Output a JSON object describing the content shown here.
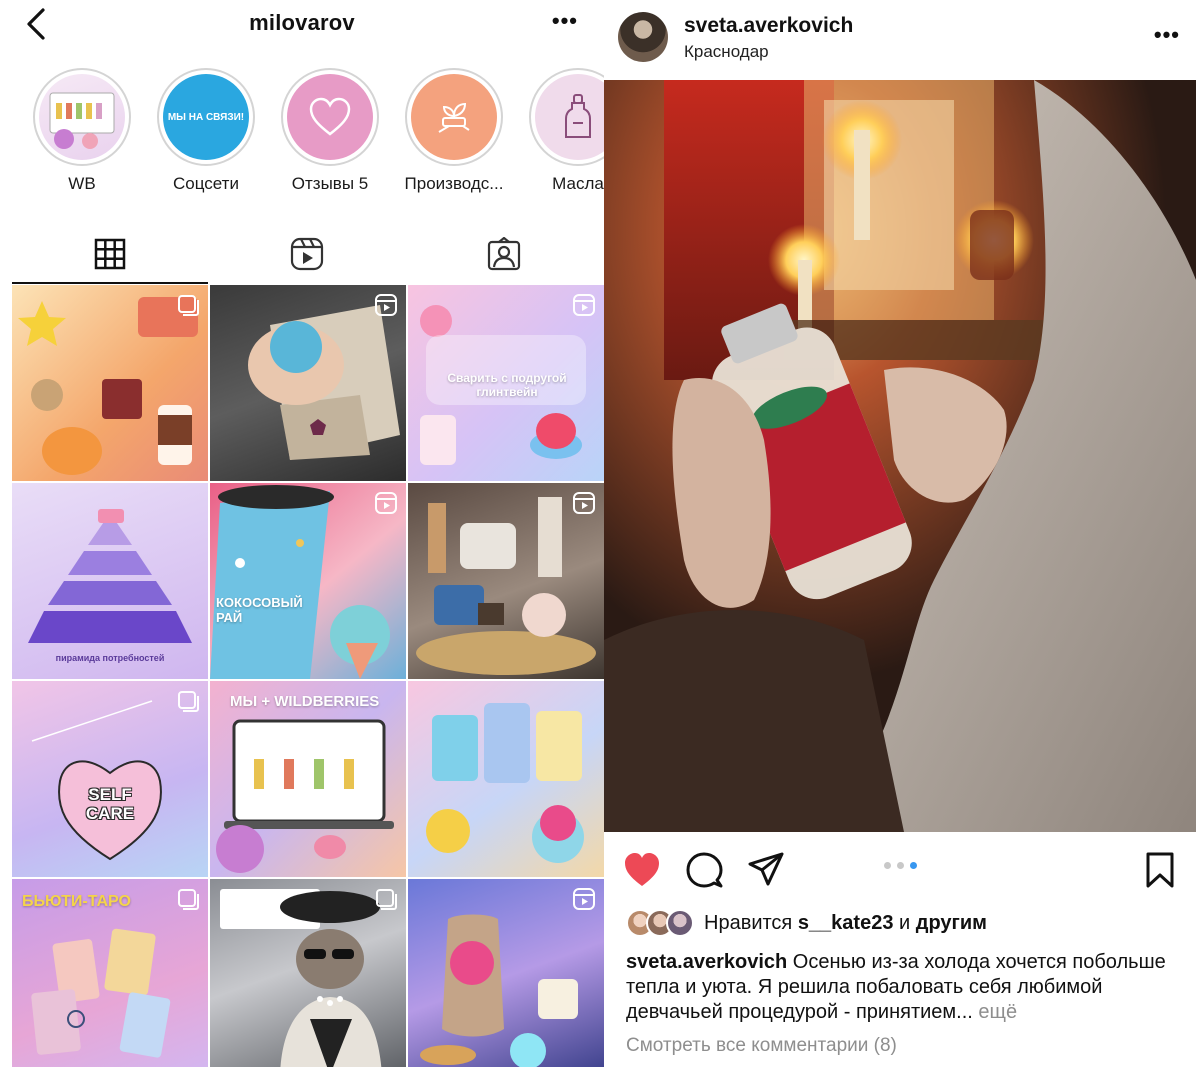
{
  "profile": {
    "username": "milovarov",
    "more": "•••",
    "highlights": [
      {
        "label": "WB",
        "icon": "laptop-products-thumb"
      },
      {
        "label": "Соцсети",
        "icon": "we-are-online-thumb",
        "thumb_text": "МЫ НА СВЯЗИ!"
      },
      {
        "label": "Отзывы 5",
        "icon": "heart-icon"
      },
      {
        "label": "Производс...",
        "icon": "hand-plant-icon"
      },
      {
        "label": "Масла",
        "icon": "oil-bottle-icon"
      }
    ],
    "tabs": [
      "grid-tab",
      "reels-tab",
      "tagged-tab"
    ]
  },
  "grid": {
    "cells": [
      {
        "caption": "",
        "badge": "multi"
      },
      {
        "caption": "",
        "badge": "reel"
      },
      {
        "caption": "Сварить с подругой глинтвейн",
        "badge": "reel"
      },
      {
        "caption": "пирамида потребностей",
        "badge": ""
      },
      {
        "caption": "КОКОСОВЫЙ РАЙ",
        "badge": "reel"
      },
      {
        "caption": "",
        "badge": "reel"
      },
      {
        "caption": "SELF CARE",
        "badge": "multi"
      },
      {
        "caption": "МЫ + WILDBERRIES",
        "badge": ""
      },
      {
        "caption": "",
        "badge": ""
      },
      {
        "caption": "БЬЮТИ-ТАРО",
        "badge": "multi"
      },
      {
        "caption": "",
        "badge": "multi"
      },
      {
        "caption": "",
        "badge": "reel"
      }
    ]
  },
  "post": {
    "username": "sveta.averkovich",
    "location": "Краснодар",
    "more": "•••",
    "carousel": {
      "total": 3,
      "active": 3
    },
    "likes_prefix": "Нравится ",
    "likes_user": "s__kate23",
    "likes_mid": " и ",
    "likes_suffix": "другим",
    "caption_user": "sveta.averkovich",
    "caption_text": " Осенью из-за холода хочется побольше тепла и уюта. Я решила побаловать себя любимой девчачьей процедурой - принятием...",
    "caption_more": " ещё",
    "comments_link": "Смотреть все комментарии (8)",
    "liked": true
  },
  "colors": {
    "like_red": "#ed4956",
    "dot_active": "#3897f0"
  }
}
